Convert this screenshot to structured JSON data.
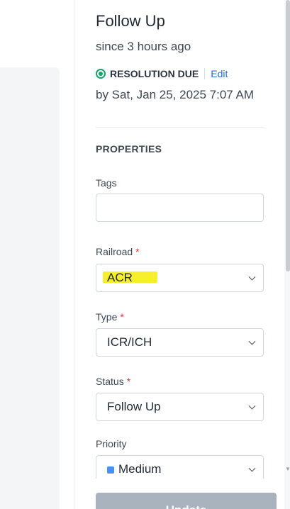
{
  "ticket": {
    "status_title": "Follow Up",
    "since": "since 3 hours ago",
    "sla_label": "RESOLUTION DUE",
    "sla_edit": "Edit",
    "due_date": "by Sat, Jan 25, 2025 7:07 AM"
  },
  "properties": {
    "heading": "PROPERTIES",
    "fields": {
      "tags": {
        "label": "Tags",
        "value": ""
      },
      "railroad": {
        "label": "Railroad",
        "required_mark": "*",
        "value": "ACR"
      },
      "type": {
        "label": "Type",
        "required_mark": "*",
        "value": "ICR/ICH"
      },
      "status": {
        "label": "Status",
        "required_mark": "*",
        "value": "Follow Up"
      },
      "priority": {
        "label": "Priority",
        "value": "Medium",
        "color": "#4a90f2"
      }
    }
  },
  "actions": {
    "update_label": "Update"
  },
  "colors": {
    "sla_ok": "#13a36b",
    "link": "#2c6bd0",
    "required": "#d03b3b",
    "highlight": "#f7ef2b",
    "disabled_button": "#a9b3bd"
  }
}
